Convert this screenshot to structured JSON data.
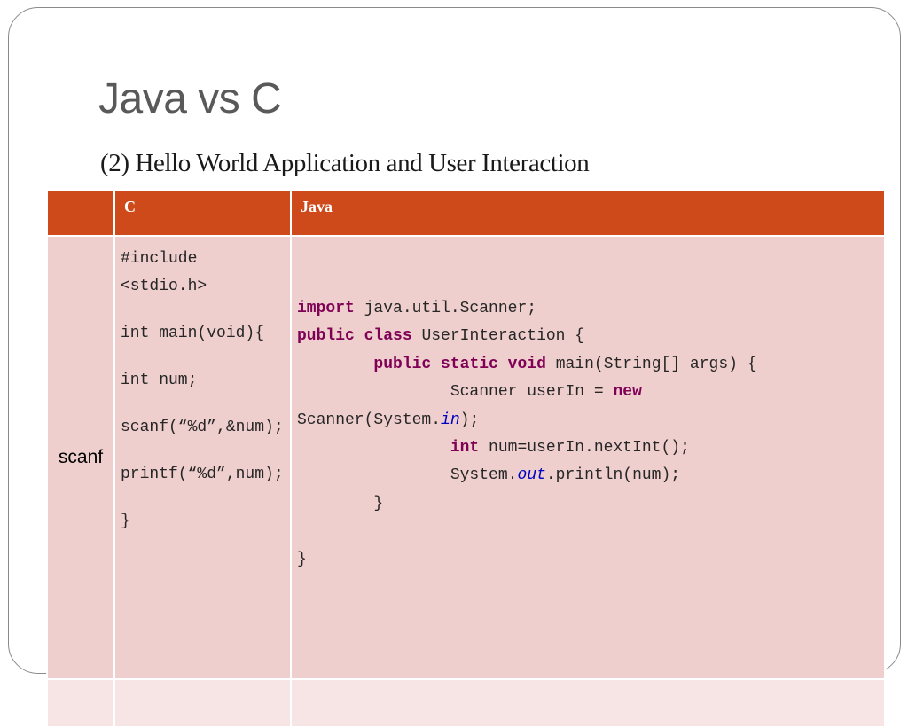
{
  "slide": {
    "title": "Java vs C",
    "subtitle": "(2) Hello World Application and User Interaction"
  },
  "table": {
    "headers": [
      "",
      "C",
      "Java"
    ],
    "row_label": "scanf",
    "c_code": {
      "p1": "#include <stdio.h>",
      "p2": "int main(void){",
      "p3": "int num;",
      "p4": "scanf(“%d”,&num);",
      "p5": "printf(“%d”,num);",
      "p6": "}"
    },
    "java_code": {
      "l1_kw": "import",
      "l1_rest": " java.util.Scanner;",
      "l2_kw1": "public",
      "l2_kw2": "class",
      "l2_rest": " UserInteraction {",
      "l3_indent": "\t",
      "l3_kw1": "public",
      "l3_kw2": "static",
      "l3_kw3": "void",
      "l3_rest": " main(String[] args) {",
      "l4_pre": "\t\tScanner userIn = ",
      "l4_kw": "new",
      "l5_pre": "Scanner(System.",
      "l5_field": "in",
      "l5_post": ");",
      "l6_indent": "\t\t",
      "l6_kw": "int",
      "l6_rest": " num=userIn.nextInt();",
      "l7_pre": "\t\tSystem.",
      "l7_field": "out",
      "l7_post": ".println(num);",
      "l8": "\t}",
      "l9": "}"
    }
  },
  "colors": {
    "header_bg": "#cf4a1b",
    "body_bg": "#efcfcd",
    "empty_row_bg": "#f6e5e4",
    "keyword": "#7f0055",
    "static_field": "#0000c0"
  }
}
